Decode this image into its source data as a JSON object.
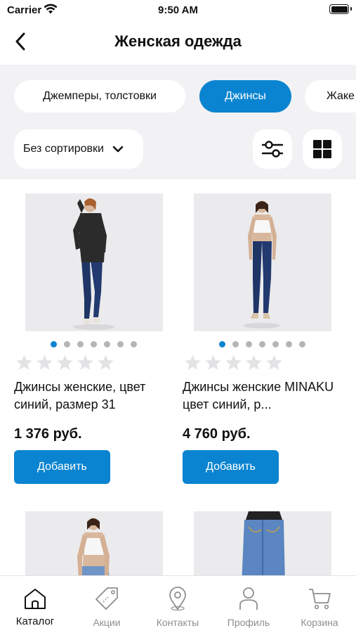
{
  "status_bar": {
    "carrier": "Carrier",
    "time": "9:50 AM"
  },
  "header": {
    "title": "Женская одежда",
    "back_icon": "chevron-left-icon"
  },
  "categories": [
    {
      "label": "Джемперы, толстовки",
      "active": false
    },
    {
      "label": "Джинсы",
      "active": true
    },
    {
      "label": "Жаке",
      "active": false
    }
  ],
  "sort": {
    "label": "Без сортировки",
    "icon": "chevron-down-icon"
  },
  "toolbar": {
    "filters_icon": "sliders-icon",
    "grid_icon": "grid-icon"
  },
  "products": [
    {
      "name": "Джинсы женские, цвет синий, размер 31",
      "price": "1 376 руб.",
      "button": "Добавить",
      "image_dots": 7,
      "active_dot": 0,
      "rating_stars": 5
    },
    {
      "name": "Джинсы женские MINAKU цвет синий, р...",
      "price": "4 760 руб.",
      "button": "Добавить",
      "image_dots": 7,
      "active_dot": 0,
      "rating_stars": 5
    },
    {
      "name": "",
      "price": "",
      "button": ""
    },
    {
      "name": "",
      "price": "",
      "button": ""
    }
  ],
  "tab_bar": [
    {
      "label": "Каталог",
      "icon": "home-icon",
      "active": true
    },
    {
      "label": "Акции",
      "icon": "tag-icon",
      "active": false
    },
    {
      "label": "Контакты",
      "icon": "map-pin-icon",
      "active": false
    },
    {
      "label": "Профиль",
      "icon": "person-icon",
      "active": false
    },
    {
      "label": "Корзина",
      "icon": "cart-icon",
      "active": false
    }
  ],
  "colors": {
    "accent": "#0a84d0",
    "panel_bg": "#f2f2f4",
    "inactive_tab": "#8e8e93"
  }
}
